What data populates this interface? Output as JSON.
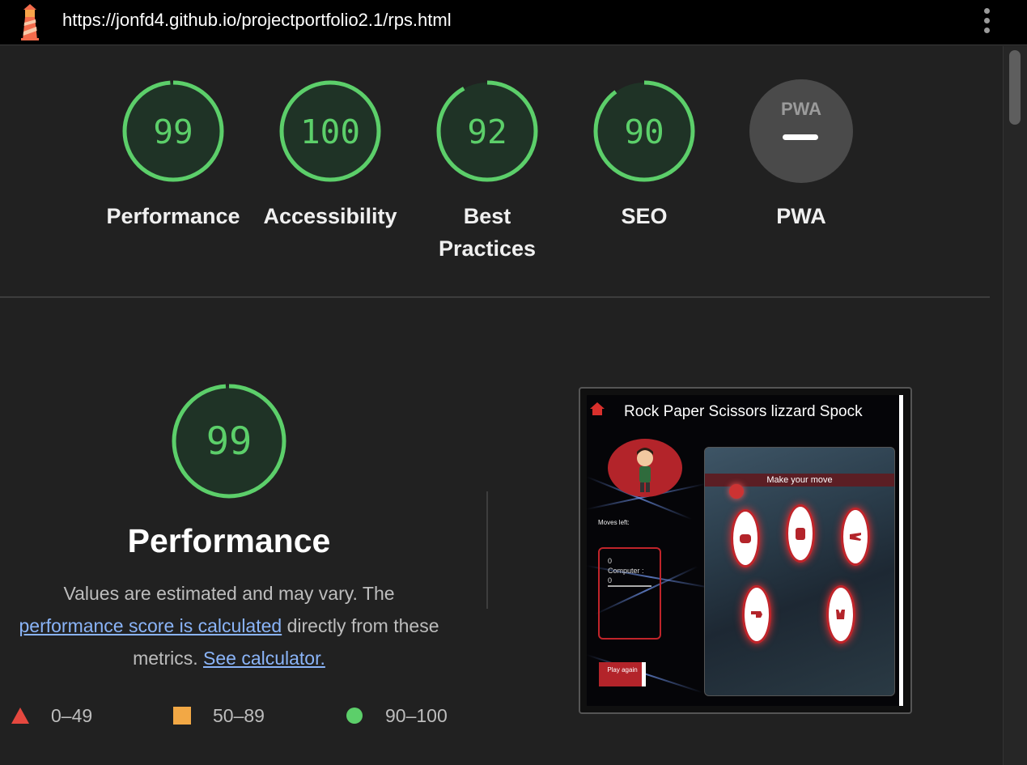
{
  "browser": {
    "url": "https://jonfd4.github.io/projectportfolio2.1/rps.html",
    "logo_icon": "lighthouse-icon",
    "menu_icon": "kebab-menu-icon"
  },
  "gauges": [
    {
      "score": "99",
      "value": 0.99,
      "label": "Performance",
      "color": "#5ccf6a"
    },
    {
      "score": "100",
      "value": 1.0,
      "label": "Accessibility",
      "color": "#5ccf6a"
    },
    {
      "score": "92",
      "value": 0.92,
      "label": "Best\nPractices",
      "color": "#5ccf6a"
    },
    {
      "score": "90",
      "value": 0.9,
      "label": "SEO",
      "color": "#5ccf6a"
    },
    {
      "score": "PWA",
      "label": "PWA",
      "color": "#4a4a4a",
      "na": true
    }
  ],
  "performance": {
    "score": "99",
    "value": 0.99,
    "title": "Performance",
    "desc_before": "Values are estimated and may vary. The ",
    "link1": "performance score is calculated",
    "desc_middle": " directly from these metrics. ",
    "link2": "See calculator."
  },
  "legend": [
    {
      "range": "0–49",
      "shape": "triangle",
      "color": "#e5483f"
    },
    {
      "range": "50–89",
      "shape": "square",
      "color": "#f2a845"
    },
    {
      "range": "90–100",
      "shape": "circle",
      "color": "#5ccf6a"
    }
  ],
  "screenshot": {
    "title": "Rock Paper Scissors lizzard Spock",
    "moves_left": "Moves left:",
    "player_score": "0",
    "computer_label": "Computer :",
    "computer_score": "0",
    "make_move": "Make your move",
    "play_again": "Play again"
  },
  "colors": {
    "background": "#212121",
    "pass": "#5ccf6a",
    "link": "#8ab4f8"
  }
}
